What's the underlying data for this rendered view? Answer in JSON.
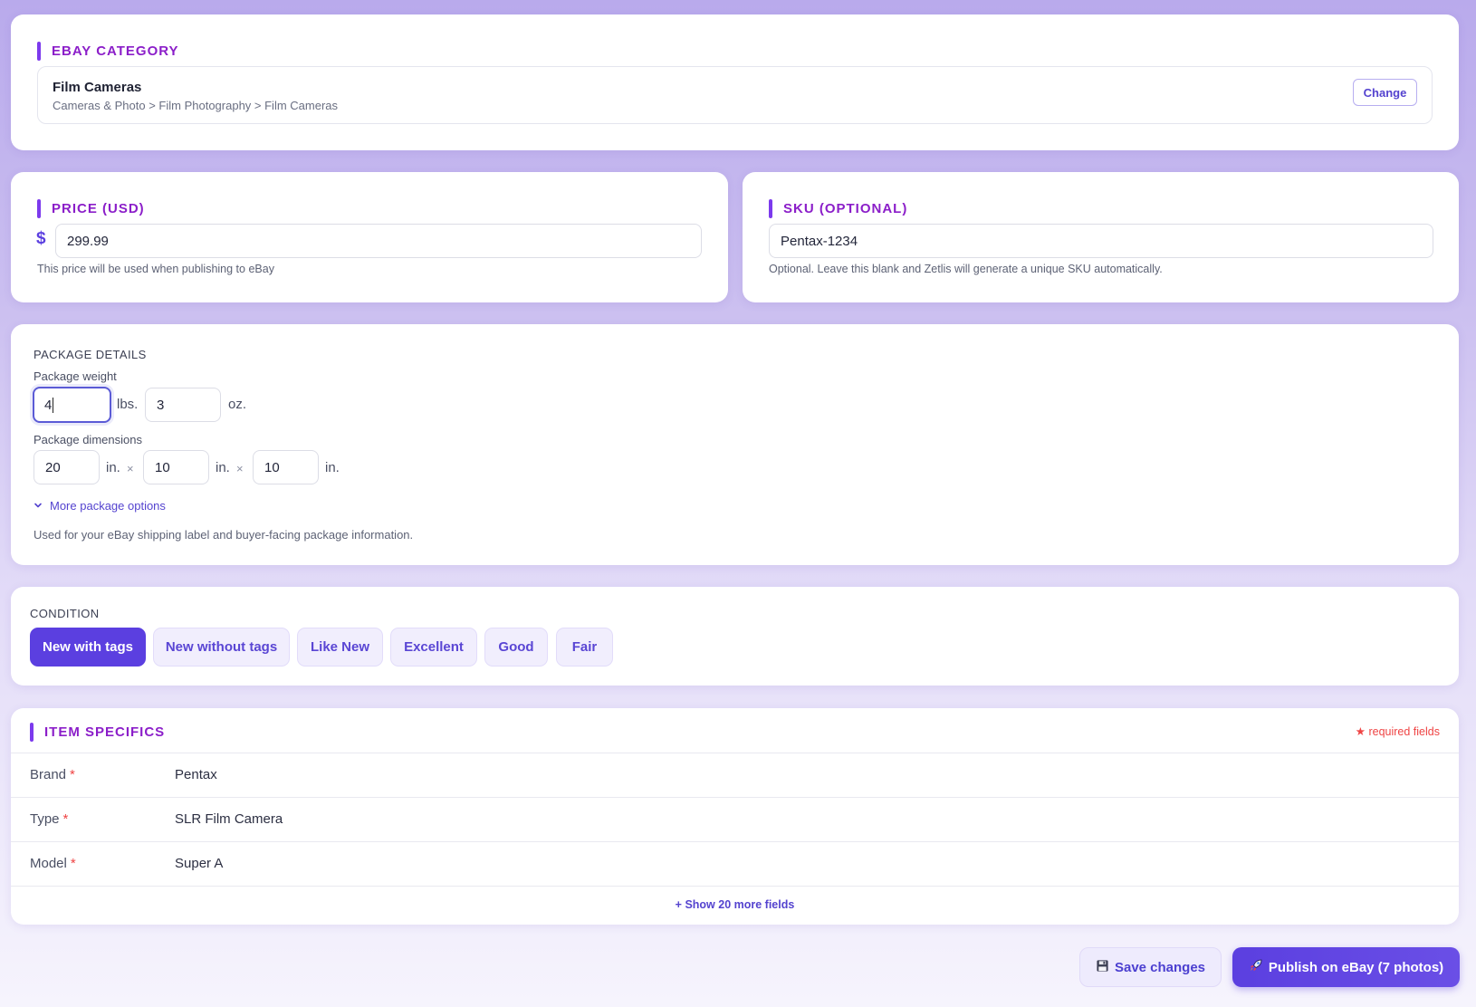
{
  "category": {
    "title": "EBAY CATEGORY",
    "name": "Film Cameras",
    "path": "Cameras & Photo > Film Photography > Film Cameras",
    "change_label": "Change"
  },
  "price": {
    "title": "PRICE (USD)",
    "currency_symbol": "$",
    "value": "299.99",
    "hint": "This price will be used when publishing to eBay"
  },
  "sku": {
    "title": "SKU (OPTIONAL)",
    "value": "Pentax-1234",
    "hint": "Optional. Leave this blank and Zetlis will generate a unique SKU automatically."
  },
  "package": {
    "title": "PACKAGE DETAILS",
    "weight_label": "Package weight",
    "weight_lbs": "4",
    "lbs_unit": "lbs.",
    "weight_oz": "3",
    "oz_unit": "oz.",
    "dimensions_label": "Package dimensions",
    "length": "20",
    "width": "10",
    "height": "10",
    "dim_unit": "in.",
    "times_symbol": "×",
    "more_options": "More package options",
    "hint": "Used for your eBay shipping label and buyer-facing package information."
  },
  "condition": {
    "title": "CONDITION",
    "options": [
      "New with tags",
      "New without tags",
      "Like New",
      "Excellent",
      "Good",
      "Fair"
    ],
    "selected": "New with tags"
  },
  "specifics": {
    "title": "ITEM SPECIFICS",
    "required_note": "★ required fields",
    "required_mark": "*",
    "rows": [
      {
        "label": "Brand",
        "value": "Pentax"
      },
      {
        "label": "Type",
        "value": "SLR Film Camera"
      },
      {
        "label": "Model",
        "value": "Super A"
      }
    ],
    "show_more": "+ Show 20 more fields"
  },
  "actions": {
    "save_label": "Save changes",
    "publish_label": "Publish on eBay (7 photos)"
  },
  "colors": {
    "accent": "#5b3fe0",
    "section_title": "#8b1ec9",
    "required": "#ef4444"
  }
}
